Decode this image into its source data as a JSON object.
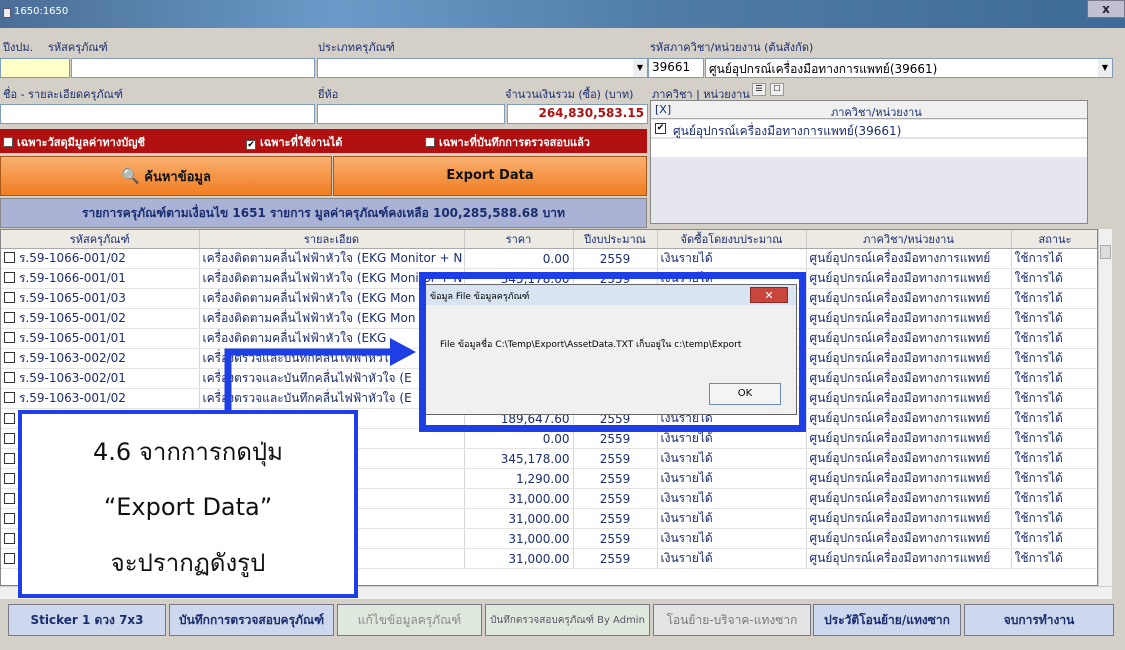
{
  "window": {
    "title": "1650:1650",
    "close_icon": "close-icon"
  },
  "filters": {
    "year_label": "ปีงปม.",
    "asset_code_label": "รหัสครุภัณฑ์",
    "type_label": "ประเภทครุภัณฑ์",
    "dept_code_label": "รหัสภาควิชา/หน่วยงาน (ต้นสังกัด)",
    "dept_code": "39661",
    "dept_name": "ศูนย์อุปกรณ์เครื่องมือทางการแพทย์(39661)",
    "name_label": "ชื่อ - รายละเอียดครุภัณฑ์",
    "brand_label": "ยี่ห้อ",
    "total_label": "จำนวนเงินรวม (ซื้อ) (บาท)",
    "total_value": "264,830,583.15",
    "dept_list_label": "ภาควิชา | หน่วยงาน"
  },
  "checkboxes": [
    {
      "label": "เฉพาะวัสดุมีมูลค่าทางบัญชี",
      "checked": false
    },
    {
      "label": "เฉพาะที่ใช้งานได้",
      "checked": true
    },
    {
      "label": "เฉพาะที่บันทึกการตรวจสอบแล้ว",
      "checked": false
    }
  ],
  "buttons": {
    "search": "ค้นหาข้อมูล",
    "export": "Export Data"
  },
  "summary": "รายการครุภัณฑ์ตามเงื่อนไข 1651 รายการ  มูลค่าครุภัณฑ์คงเหลือ 100,285,588.68 บาท",
  "dept_panel": {
    "col_check": "[X]",
    "col_name": "ภาควิชา/หน่วยงาน",
    "rows": [
      {
        "checked": true,
        "name": "ศูนย์อุปกรณ์เครื่องมือทางการแพทย์(39661)"
      }
    ]
  },
  "grid": {
    "columns": [
      "รหัสครุภัณฑ์",
      "รายละเอียด",
      "ราคา",
      "ปีงบประมาณ",
      "จัดซื้อโดยงบประมาณ",
      "ภาควิชา/หน่วยงาน",
      "สถานะ"
    ],
    "rows": [
      {
        "code": "ร.59-1066-001/02",
        "desc": "เครื่องติดตามคลื่นไฟฟ้าหัวใจ (EKG Monitor + N",
        "price": "0.00",
        "year": "2559",
        "budget": "เงินรายได้",
        "dept": "ศูนย์อุปกรณ์เครื่องมือทางการแพทย์",
        "status": "ใช้การได้"
      },
      {
        "code": "ร.59-1066-001/01",
        "desc": "เครื่องติดตามคลื่นไฟฟ้าหัวใจ (EKG Monitor + N",
        "price": "345,178.00",
        "year": "2559",
        "budget": "เงินรายได้",
        "dept": "ศูนย์อุปกรณ์เครื่องมือทางการแพทย์",
        "status": "ใช้การได้"
      },
      {
        "code": "ร.59-1065-001/03",
        "desc": "เครื่องติดตามคลื่นไฟฟ้าหัวใจ (EKG Mon",
        "price": "",
        "year": "",
        "budget": "",
        "dept": "ศูนย์อุปกรณ์เครื่องมือทางการแพทย์",
        "status": "ใช้การได้"
      },
      {
        "code": "ร.59-1065-001/02",
        "desc": "เครื่องติดตามคลื่นไฟฟ้าหัวใจ (EKG Mon",
        "price": "",
        "year": "",
        "budget": "",
        "dept": "ศูนย์อุปกรณ์เครื่องมือทางการแพทย์",
        "status": "ใช้การได้"
      },
      {
        "code": "ร.59-1065-001/01",
        "desc": "เครื่องติดตามคลื่นไฟฟ้าหัวใจ (EKG",
        "price": "",
        "year": "",
        "budget": "",
        "dept": "ศูนย์อุปกรณ์เครื่องมือทางการแพทย์",
        "status": "ใช้การได้"
      },
      {
        "code": "ร.59-1063-002/02",
        "desc": "เครื่องตรวจและบันทึกคลื่นไฟฟ้าหัวใ",
        "price": "",
        "year": "",
        "budget": "",
        "dept": "ศูนย์อุปกรณ์เครื่องมือทางการแพทย์",
        "status": "ใช้การได้"
      },
      {
        "code": "ร.59-1063-002/01",
        "desc": "เครื่องตรวจและบันทึกคลื่นไฟฟ้าหัวใจ (E",
        "price": "",
        "year": "",
        "budget": "",
        "dept": "ศูนย์อุปกรณ์เครื่องมือทางการแพทย์",
        "status": "ใช้การได้"
      },
      {
        "code": "ร.59-1063-001/02",
        "desc": "เครื่องตรวจและบันทึกคลื่นไฟฟ้าหัวใจ (E",
        "price": "",
        "year": "",
        "budget": "",
        "dept": "ศูนย์อุปกรณ์เครื่องมือทางการแพทย์",
        "status": "ใช้การได้"
      },
      {
        "code": "",
        "desc": "(EKG 12 ล",
        "price": "189,647.60",
        "year": "2559",
        "budget": "เงินรายได้",
        "dept": "ศูนย์อุปกรณ์เครื่องมือทางการแพทย์",
        "status": "ใช้การได้"
      },
      {
        "code": "",
        "desc": "Monitor + N",
        "price": "0.00",
        "year": "2559",
        "budget": "เงินรายได้",
        "dept": "ศูนย์อุปกรณ์เครื่องมือทางการแพทย์",
        "status": "ใช้การได้"
      },
      {
        "code": "",
        "desc": "Monitor + N",
        "price": "345,178.00",
        "year": "2559",
        "budget": "เงินรายได้",
        "dept": "ศูนย์อุปกรณ์เครื่องมือทางการแพทย์",
        "status": "ใช้การได้"
      },
      {
        "code": "",
        "desc": "ระดับได้",
        "price": "1,290.00",
        "year": "2559",
        "budget": "เงินรายได้",
        "dept": "ศูนย์อุปกรณ์เครื่องมือทางการแพทย์",
        "status": "ใช้การได้"
      },
      {
        "code": "",
        "desc": "เลือดส่วนปล",
        "price": "31,000.00",
        "year": "2559",
        "budget": "เงินรายได้",
        "dept": "ศูนย์อุปกรณ์เครื่องมือทางการแพทย์",
        "status": "ใช้การได้"
      },
      {
        "code": "",
        "desc": "เลือดส่วนปล",
        "price": "31,000.00",
        "year": "2559",
        "budget": "เงินรายได้",
        "dept": "ศูนย์อุปกรณ์เครื่องมือทางการแพทย์",
        "status": "ใช้การได้"
      },
      {
        "code": "",
        "desc": "เลือดส่วนปล",
        "price": "31,000.00",
        "year": "2559",
        "budget": "เงินรายได้",
        "dept": "ศูนย์อุปกรณ์เครื่องมือทางการแพทย์",
        "status": "ใช้การได้"
      },
      {
        "code": "",
        "desc": "เลือดส่วนปล",
        "price": "31,000.00",
        "year": "2559",
        "budget": "เงินรายได้",
        "dept": "ศูนย์อุปกรณ์เครื่องมือทางการแพทย์",
        "status": "ใช้การได้"
      }
    ]
  },
  "bottom": {
    "sticker": "Sticker 1 ดวง 7x3",
    "record_check": "บันทึกการตรวจสอบครุภัณฑ์",
    "edit": "แก้ไขข้อมูลครุภัณฑ์",
    "record_by_admin": "บันทึกตรวจสอบครุภัณฑ์ By Admin",
    "transfer": "โอนย้าย-บริจาค-แทงซาก",
    "history": "ประวัติโอนย้าย/แทงซาก",
    "finish": "จบการทำงาน"
  },
  "dialog": {
    "title": "ข้อมูล File ข้อมูลครุภัณฑ์",
    "message": "File ข้อมูลชื่อ C:\\Temp\\Export\\AssetData.TXT เก็บอยู่ใน c:\\temp\\Export",
    "ok": "OK"
  },
  "annotation": {
    "line1": "4.6 จากการกดปุ่ม",
    "line2": "“Export Data”",
    "line3": "จะปรากฏดังรูป"
  },
  "colors": {
    "highlight": "#1f3fe6",
    "filter_bar": "#b01010",
    "orange": "#f07d22",
    "summary_bg": "#aab2d6"
  }
}
